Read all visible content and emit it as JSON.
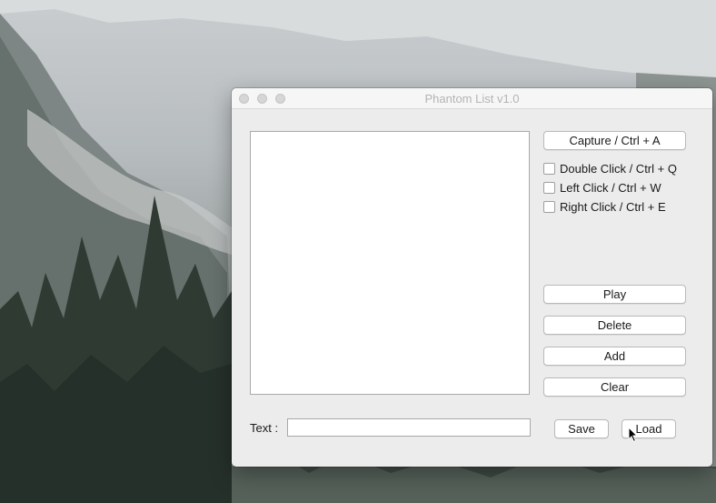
{
  "window": {
    "title": "Phantom List v1.0"
  },
  "capture_button": "Capture / Ctrl + A",
  "checkboxes": [
    {
      "label": "Double Click / Ctrl + Q",
      "checked": false
    },
    {
      "label": "Left Click / Ctrl + W",
      "checked": false
    },
    {
      "label": "Right Click / Ctrl + E",
      "checked": false
    }
  ],
  "buttons": {
    "play": "Play",
    "delete": "Delete",
    "add": "Add",
    "clear": "Clear",
    "save": "Save",
    "load": "Load"
  },
  "text_field": {
    "label": "Text :",
    "value": ""
  },
  "icons": [
    "close-icon",
    "minimize-icon",
    "zoom-icon",
    "mouse-cursor-icon"
  ]
}
